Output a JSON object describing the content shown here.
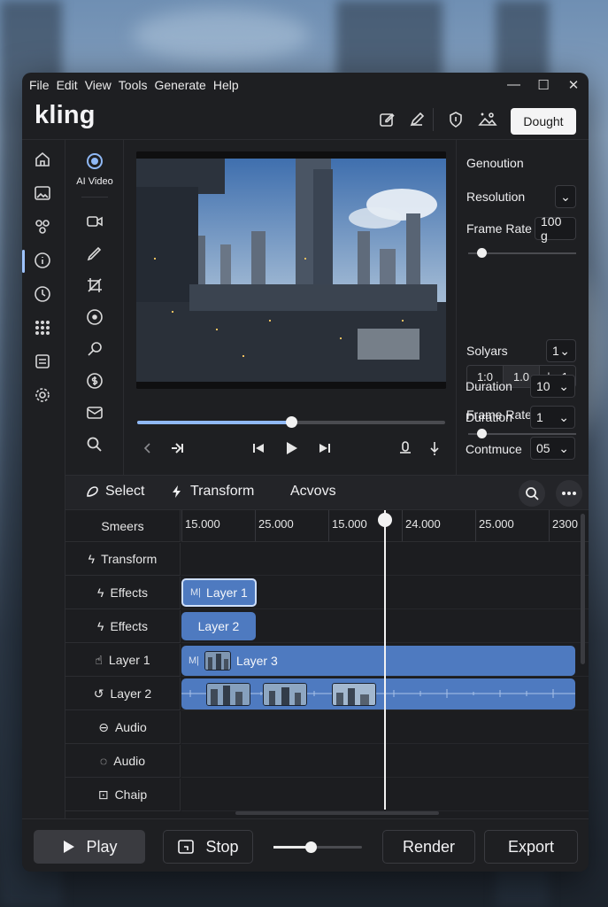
{
  "menu": [
    "File",
    "Edit",
    "View",
    "Tools",
    "Generate",
    "Help"
  ],
  "window_controls": [
    "—",
    "☐",
    "✕"
  ],
  "app": {
    "logo": "kling",
    "header_button": "Dought"
  },
  "tools": {
    "ai_label": "AI Video"
  },
  "props": {
    "title": "Genoution",
    "resolution_label": "Resolution",
    "frame_rate_label": "Frame Rate",
    "frame_rate_value": "100 g",
    "frame_rate_slider": 0.12,
    "solyars_label": "Solyars",
    "solyars_value": "1",
    "segments": [
      "1:0",
      "1.0",
      "|→1"
    ],
    "frame_rate2_label": "Frame Rate",
    "frame_rate2_slider": 0.12,
    "duration_label": "Duration",
    "duration_value": "10",
    "duration2_label": "Duration",
    "duration2_value": "1",
    "contmuce_label": "Contmuce",
    "contmuce_value": "05"
  },
  "player": {
    "progress": 0.5
  },
  "timeline_toolbar": {
    "select": "Select",
    "transform": "Transform",
    "acvovs": "Acvovs"
  },
  "timeline": {
    "ruler_label": "Smeers",
    "ticks": [
      "15.000",
      "25.000",
      "15.000",
      "24.000",
      "25.000",
      "2300"
    ],
    "tracks": [
      {
        "name": "Transform",
        "icon": "bolt-icon"
      },
      {
        "name": "Effects",
        "icon": "bolt-icon"
      },
      {
        "name": "Effects",
        "icon": "bolt-icon"
      },
      {
        "name": "Layer 1",
        "icon": "hand-icon"
      },
      {
        "name": "Layer 2",
        "icon": "undo-icon"
      },
      {
        "name": "Audio",
        "icon": "minus-circle-icon"
      },
      {
        "name": "Audio",
        "icon": "dashed-circle-icon"
      },
      {
        "name": "Chaip",
        "icon": "focus-icon"
      }
    ],
    "clips": {
      "layer1": "Layer 1",
      "layer2": "Layer 2",
      "layer3": "Layer 3",
      "marker": "M|"
    }
  },
  "bottom": {
    "play": "Play",
    "stop": "Stop",
    "volume": 0.42,
    "render": "Render",
    "export": "Export"
  },
  "colors": {
    "clip": "#4e7ac0",
    "accent": "#8fb8f5",
    "panel": "#1e1f22"
  }
}
